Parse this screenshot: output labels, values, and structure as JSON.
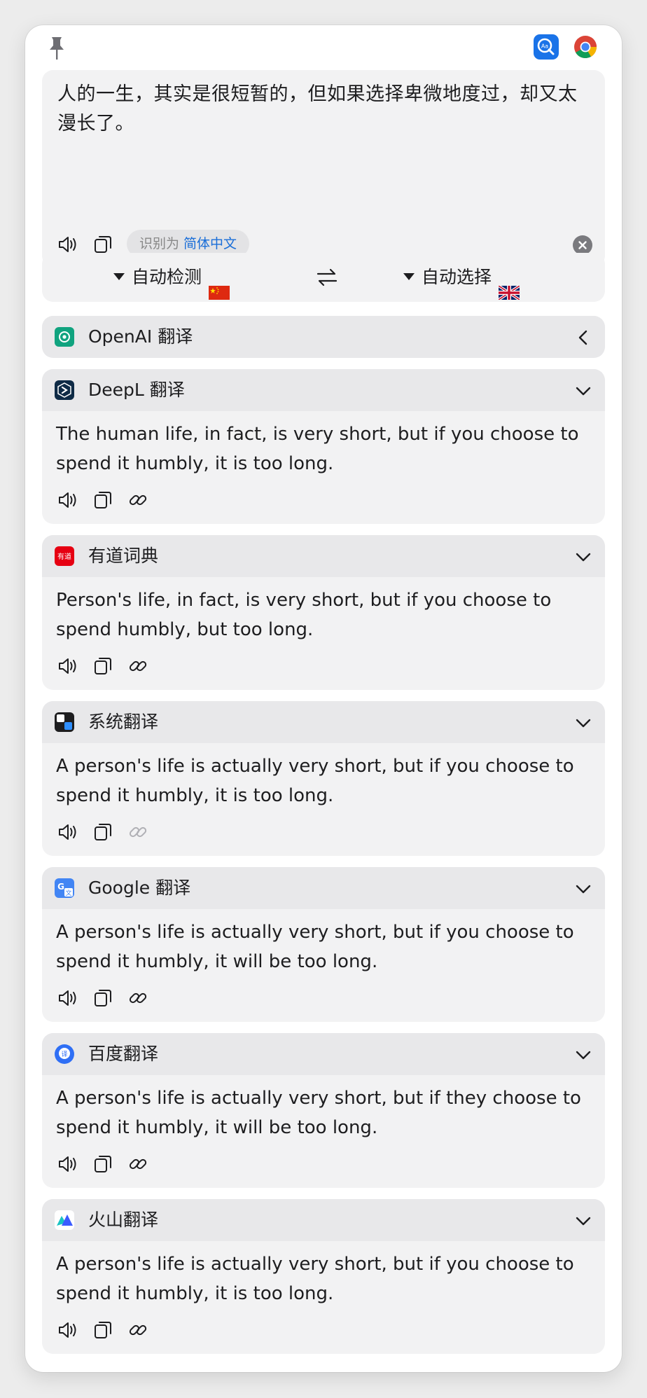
{
  "input": {
    "text": "人的一生，其实是很短暂的，但如果选择卑微地度过，却又太漫长了。",
    "detected_prefix": "识别为",
    "detected_lang": "简体中文"
  },
  "lang_bar": {
    "source": "自动检测",
    "target": "自动选择"
  },
  "services": [
    {
      "name": "OpenAI 翻译",
      "collapsed": true
    },
    {
      "name": "DeepL 翻译",
      "text": "The human life, in fact, is very short, but if you choose to spend it humbly, it is too long."
    },
    {
      "name": "有道词典",
      "logo_text": "有道",
      "text": "Person's life, in fact, is very short, but if you choose to spend humbly, but too long."
    },
    {
      "name": "系统翻译",
      "text": "A person's life is actually very short, but if you choose to spend it humbly, it is too long."
    },
    {
      "name": "Google 翻译",
      "text": "A person's life is actually very short, but if you choose to spend it humbly, it will be too long."
    },
    {
      "name": "百度翻译",
      "text": "A person's life is actually very short, but if they choose to spend it humbly, it will be too long."
    },
    {
      "name": "火山翻译",
      "text": "A person's life is actually very short, but if you choose to spend it humbly, it is too long."
    }
  ],
  "colors": {
    "accent": "#1a6ed8",
    "panel_bg": "#f2f2f3",
    "header_bg": "#e8e8ea",
    "openai": "#10a37f",
    "youdao": "#e60012",
    "deepl": "#0f2b46"
  },
  "icons": {
    "pin": "pin-icon",
    "dictionary_app": "dictionary-app-icon",
    "chrome": "chrome-icon",
    "speaker": "speaker-icon",
    "copy": "copy-icon",
    "link": "link-icon",
    "swap": "swap-icon",
    "chevron_down": "chevron-down-icon",
    "chevron_left": "chevron-left-icon",
    "clear": "clear-icon"
  }
}
